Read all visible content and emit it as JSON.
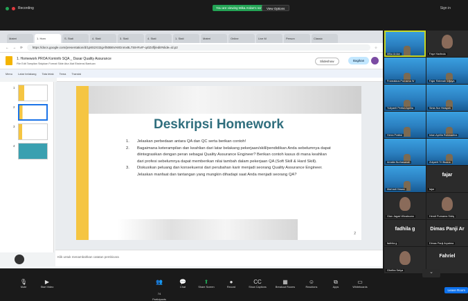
{
  "zoom_top": {
    "recording": "Recording",
    "viewing_banner": "You are viewing Mika Ardan's screen",
    "view_options": "View Options",
    "sign_in": "Sign in"
  },
  "browser": {
    "tabs": [
      "Materi",
      "1. Hom",
      "S. Stati",
      "4. Stati",
      "3. Stati",
      "4. Stati",
      "1. Stati",
      "Materi",
      "Online",
      "Live M",
      "Person",
      "Classic"
    ],
    "url": "https://docs.google.com/presentation/d/1p8S2X32gAf50B6VA8Gnmx8L7S8-RvrF-q4lZ4lfj/edit#slide=id.p2"
  },
  "docs": {
    "title": "1. Homework PROA Kominfo SQA _ Dasar Quality Assurance",
    "menu": "File  Edit  Tampilan  Sisipkan  Format  Slide  Atur  Alat  Ekstensi  Bantuan",
    "slideshow": "Slideshow",
    "share": "Bagikan",
    "toolbar": [
      "Menu",
      "Latar belakang",
      "Tata letak",
      "Tema",
      "Transisi"
    ],
    "notes_placeholder": "Klik untuk menambahkan catatan pembicara"
  },
  "slide": {
    "title": "Deskripsi Homework",
    "items": [
      {
        "num": "1.",
        "text": "Jelaskan perbedaan antara QA dan QC serta berikan contoh!"
      },
      {
        "num": "2.",
        "text": "Bagaimana keterampilan dan keahlian dari latar belakang pekerjaan/skill/pendidikan Anda sebelumnya dapat diintegrasikan dengan peran sebagai Quality Assurance Engineer? Berikan contoh kasus di mana keahlian dari profesi sebelumnya dapat memberikan nilai tambah dalam pekerjaan QA (Soft Skill & Hard Skill)."
      },
      {
        "num": "3.",
        "text": "Diskusikan peluang dan konsekuensi dari perubahan karir menjadi seorang Quality Assurance Engineer. Jelaskan manfaat dan tantangan yang mungkin dihadapi saat Anda menjadi seorang QA?"
      }
    ],
    "page": "2"
  },
  "thumbnails": [
    "1",
    "2",
    "3",
    "4"
  ],
  "participants": [
    {
      "name": "Mika Ardan",
      "big": "",
      "bg": "sky"
    },
    {
      "name": "Faye Harlinda",
      "big": "",
      "bg": "dark"
    },
    {
      "name": "Fransiskus Purnama W",
      "big": "",
      "bg": "sky"
    },
    {
      "name": "Fajar Rahmah Wijaya",
      "big": "",
      "bg": "sky"
    },
    {
      "name": "Yuliyanti Pertiwi Aprilia",
      "big": "",
      "bg": "sky"
    },
    {
      "name": "Sinta Nur Hidayah",
      "big": "",
      "bg": "sky"
    },
    {
      "name": "Herra Pratiwi",
      "big": "",
      "bg": "sky"
    },
    {
      "name": "Intan Aprilia Rahmadina",
      "big": "",
      "bg": "sky"
    },
    {
      "name": "Amalia Nurhasanah",
      "big": "",
      "bg": "sky"
    },
    {
      "name": "Zulyanti Tri Buana",
      "big": "",
      "bg": "sky"
    },
    {
      "name": "Marhadi Hasan",
      "big": "",
      "bg": "sky"
    },
    {
      "name": "fajar",
      "big": "fajar",
      "bg": "dark"
    },
    {
      "name": "Gian Jagad Wicaksono",
      "big": "",
      "bg": "dark"
    },
    {
      "name": "Hendi Purnama Sidiq",
      "big": "",
      "bg": "dark"
    },
    {
      "name": "fadhila g",
      "big": "fadhila g",
      "bg": "dark"
    },
    {
      "name": "Dimas Panji Aryatma",
      "big": "Dimas Panji Ar",
      "bg": "dark"
    },
    {
      "name": "Ghefira Setya",
      "big": "",
      "bg": "dark"
    },
    {
      "name": "Fahriel",
      "big": "Fahriel",
      "bg": "dark"
    }
  ],
  "zoom_bottom": {
    "buttons": [
      {
        "label": "Mute",
        "icon": "🎙"
      },
      {
        "label": "Start Video",
        "icon": "▶"
      },
      {
        "label": "Participants",
        "icon": "👥",
        "count": "74"
      },
      {
        "label": "Chat",
        "icon": "💬"
      },
      {
        "label": "Share Screen",
        "icon": "⬆"
      },
      {
        "label": "Record",
        "icon": "●"
      },
      {
        "label": "Show Captions",
        "icon": "CC"
      },
      {
        "label": "Breakout Rooms",
        "icon": "▦"
      },
      {
        "label": "Reactions",
        "icon": "☺"
      },
      {
        "label": "Apps",
        "icon": "⧉"
      },
      {
        "label": "Whiteboards",
        "icon": "▭"
      }
    ],
    "leave": "Leave Room"
  },
  "colors": {
    "accent_title": "#2f6e7d",
    "slide_band": "#f5c542",
    "share_green": "#23a455",
    "leave_blue": "#0e72ed"
  }
}
